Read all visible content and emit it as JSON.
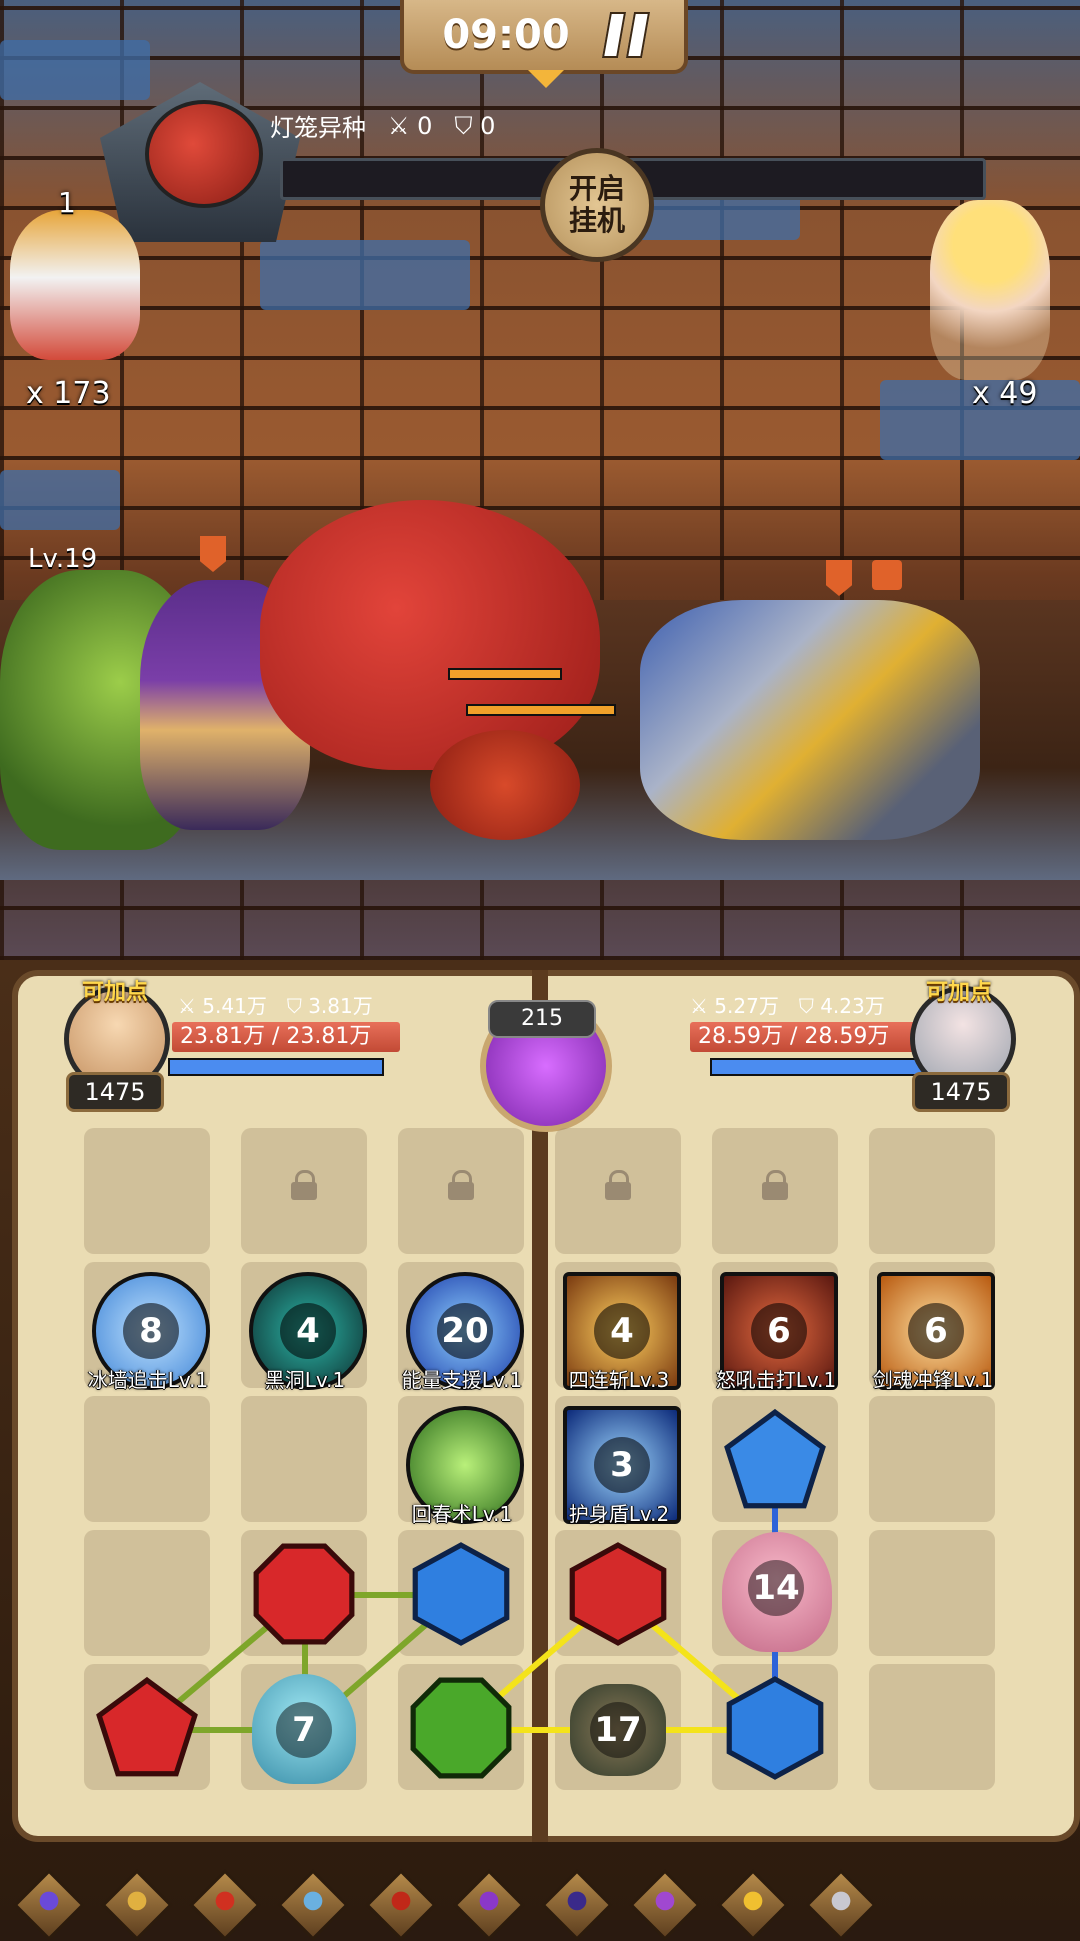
{
  "hud": {
    "timer": "09:00"
  },
  "boss": {
    "name": "灯笼异种",
    "attack": "0",
    "defense": "0",
    "afk_line1": "开启",
    "afk_line2": "挂机"
  },
  "summons": {
    "left_top_count": "1",
    "left_count": "x 173",
    "right_count": "x 49"
  },
  "team": {
    "level": "Lv.19"
  },
  "left_hero": {
    "tag": "可加点",
    "attack": "5.41万",
    "defense": "3.81万",
    "hp": "23.81万 / 23.81万",
    "mp_percent": 100,
    "level": "1475"
  },
  "right_hero": {
    "tag": "可加点",
    "attack": "5.27万",
    "defense": "4.23万",
    "hp": "28.59万 / 28.59万",
    "mp_percent": 100,
    "level": "1475"
  },
  "center": {
    "energy": "215"
  },
  "skills": [
    {
      "num": "8",
      "name": "冰墙追击Lv.1",
      "color": "#6fb6ff"
    },
    {
      "num": "4",
      "name": "黑洞Lv.1",
      "color": "#1f6b6a"
    },
    {
      "num": "20",
      "name": "能量支援Lv.1",
      "color": "#2a5fd6"
    },
    {
      "num": "4",
      "name": "四连斩Lv.3",
      "color": "#d08a2a"
    },
    {
      "num": "6",
      "name": "怒吼击打Lv.1",
      "color": "#b83a2a"
    },
    {
      "num": "6",
      "name": "剑魂冲锋Lv.1",
      "color": "#e08a20"
    },
    {
      "name": "回春术Lv.1",
      "color": "#4caa3a"
    },
    {
      "num": "3",
      "name": "护身盾Lv.2",
      "color": "#2d73d8"
    }
  ],
  "units": {
    "slime": "7",
    "octopus": "14",
    "cannon": "17"
  },
  "toolbar_icons": [
    "moon-staff-icon",
    "spellbook-icon",
    "red-spider-icon",
    "key-staff-icon",
    "red-cube-icon",
    "purple-rose-icon",
    "dark-feather-icon",
    "purple-mask-icon",
    "golden-horn-icon",
    "bone-dagger-icon"
  ]
}
